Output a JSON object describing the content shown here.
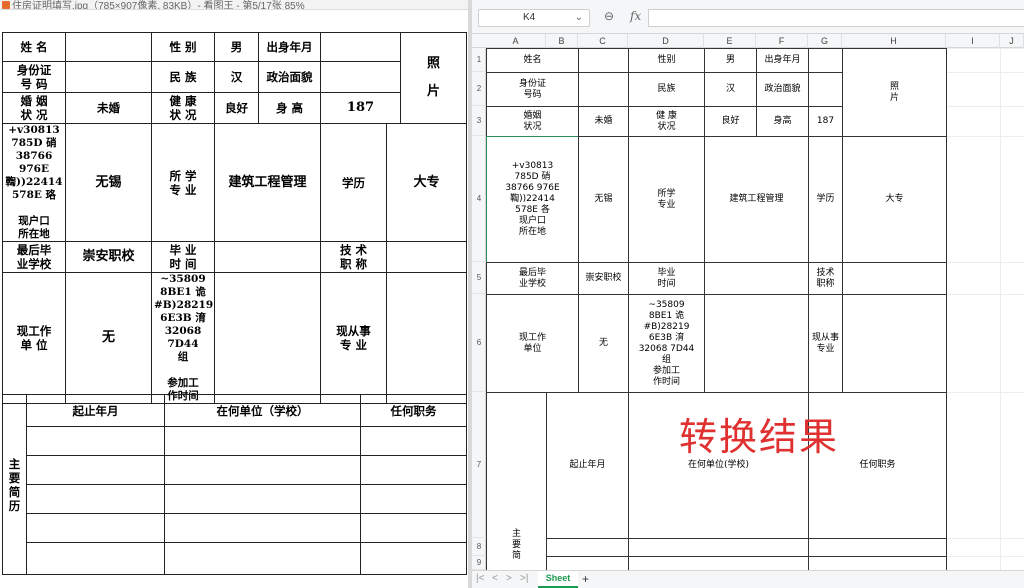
{
  "viewer": {
    "title": "住房证明填写.jpg（785×907像素, 83KB）- 看图王 - 第5/17张 85%",
    "form_top": {
      "name_label": "姓  名",
      "gender_label": "性  别",
      "gender": "男",
      "birth_label": "出身年月",
      "photo_label": "照\n\n片",
      "id_label": "身份证\n号  码",
      "ethnic_label": "民  族",
      "ethnic": "汉",
      "political_label": "政治面貌",
      "marital_label": "婚  姻\n状  况",
      "marital": "未婚",
      "health_label": "健  康\n状  况",
      "health": "良好",
      "height_label": "身  高",
      "height": "187",
      "hukou_block": "+v30813\n785D 硝\n38766 976E\n鞫))22414\n578E 珞\n\n现户口\n所在地",
      "hukou": "无锡",
      "major_label": "所  学\n专  业",
      "major": "建筑工程管理",
      "edu_label": "学历",
      "edu": "大专",
      "school_label": "最后毕\n业学校",
      "school": "崇安职校",
      "grad_label": "毕  业\n时  间",
      "title_label": "技  术\n职  称",
      "work_label": "现工作\n单  位",
      "work": "无",
      "joinwork_block": "~35809\n8BE1 诡\n#B)28219\n6E3B 淯\n32068 7D44\n组\n\n参加工\n作时间",
      "job_label": "现从事\n专  业"
    },
    "form_bottom": {
      "side_label": "主\n要\n简\n历",
      "col1": "起止年月",
      "col2": "在何单位（学校）",
      "col3": "任何职务"
    }
  },
  "sheet": {
    "namebox": "K4",
    "zoom_icon": "⊖",
    "fx_icon": "fx",
    "namebox_arrow": "⌄",
    "columns": [
      "A",
      "B",
      "C",
      "D",
      "E",
      "F",
      "G",
      "H",
      "I",
      "J"
    ],
    "rows": [
      "1",
      "2",
      "3",
      "4",
      "5",
      "6",
      "7",
      "8",
      "9"
    ],
    "cells": {
      "a1": "姓名",
      "d1": "性别",
      "e1": "男",
      "f1": "出身年月",
      "h1": "照\n片",
      "a2": "身份证\n号码",
      "d2": "民族",
      "e2": "汉",
      "f2": "政治面貌",
      "a3": "婚姻\n状况",
      "c3": "未婚",
      "d3": "健 康\n状况",
      "e3": "良好",
      "f3": "身高",
      "g3": "187",
      "a4": "+v30813\n785D 硝\n38766 976E\n鞫))22414\n578E 各\n现户口\n所在地",
      "c4": "无锡",
      "d4": "所学\n专业",
      "e4": "建筑工程管理",
      "g4": "学历",
      "h4": "大专",
      "a5": "最后毕\n业学校",
      "c5": "崇安职校",
      "d5": "毕业\n时间",
      "g5": "技术\n职称",
      "a6": "现工作\n单位",
      "c6": "无",
      "d6": "~35809\n8BE1 诡\n#B)28219\n6E3B 淯\n32068 7D44\n组\n参加工\n作时间",
      "g6": "现从事\n专业",
      "a7": "主\n要\n简",
      "b7": "起止年月",
      "d7": "在何单位(学校)",
      "g7": "任何职务"
    },
    "watermark": "转换结果",
    "tab_name": "Sheet",
    "add_tab": "+",
    "nav": [
      "|<",
      "<",
      ">",
      ">|"
    ]
  }
}
